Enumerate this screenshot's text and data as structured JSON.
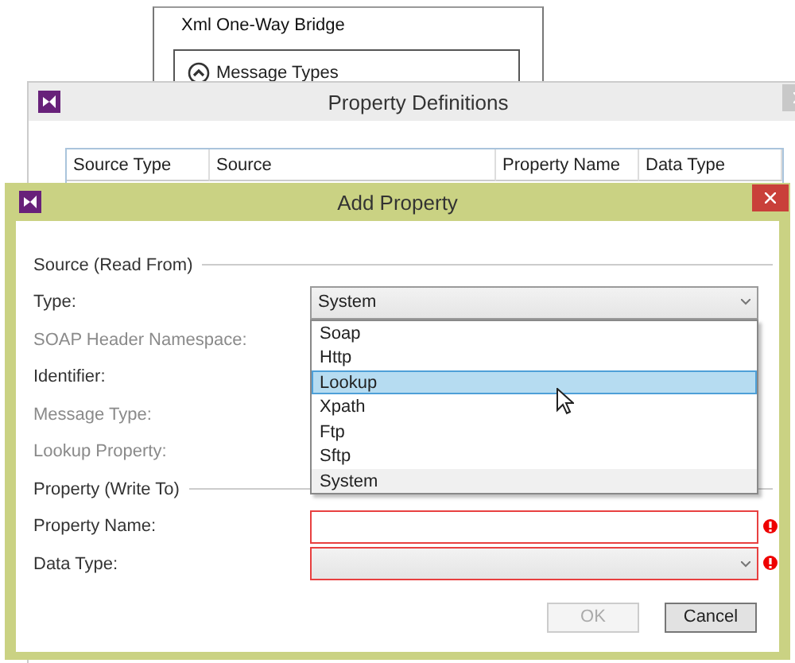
{
  "background_window": {
    "title": "Xml One-Way Bridge",
    "group": {
      "label": "Message Types",
      "expanded": true
    }
  },
  "property_definitions": {
    "title": "Property Definitions",
    "table": {
      "columns": [
        "Source Type",
        "Source",
        "Property Name",
        "Data Type"
      ]
    }
  },
  "dialog": {
    "title": "Add Property",
    "sections": [
      {
        "heading": "Source (Read From)",
        "fields": [
          {
            "label": "Type:",
            "kind": "combo",
            "disabled": false,
            "value": "System",
            "expanded": true,
            "error": false
          },
          {
            "label": "SOAP Header Namespace:",
            "kind": "label",
            "disabled": true
          },
          {
            "label": "Identifier:",
            "kind": "label",
            "disabled": false
          },
          {
            "label": "Message Type:",
            "kind": "label",
            "disabled": true
          },
          {
            "label": "Lookup Property:",
            "kind": "label",
            "disabled": true
          }
        ]
      },
      {
        "heading": "Property (Write To)",
        "fields": [
          {
            "label": "Property Name:",
            "kind": "text",
            "disabled": false,
            "error": true
          },
          {
            "label": "Data Type:",
            "kind": "combo",
            "disabled": false,
            "expanded": false,
            "error": true
          }
        ]
      }
    ],
    "dropdown": {
      "options": [
        {
          "label": "Soap",
          "selected": false
        },
        {
          "label": "Http",
          "selected": false
        },
        {
          "label": "Lookup",
          "selected": true
        },
        {
          "label": "Xpath",
          "selected": false
        },
        {
          "label": "Ftp",
          "selected": false
        },
        {
          "label": "Sftp",
          "selected": false
        },
        {
          "label": "System",
          "selected": false
        }
      ]
    },
    "buttons": [
      {
        "label": "OK",
        "disabled": true
      },
      {
        "label": "Cancel",
        "disabled": false
      }
    ]
  }
}
